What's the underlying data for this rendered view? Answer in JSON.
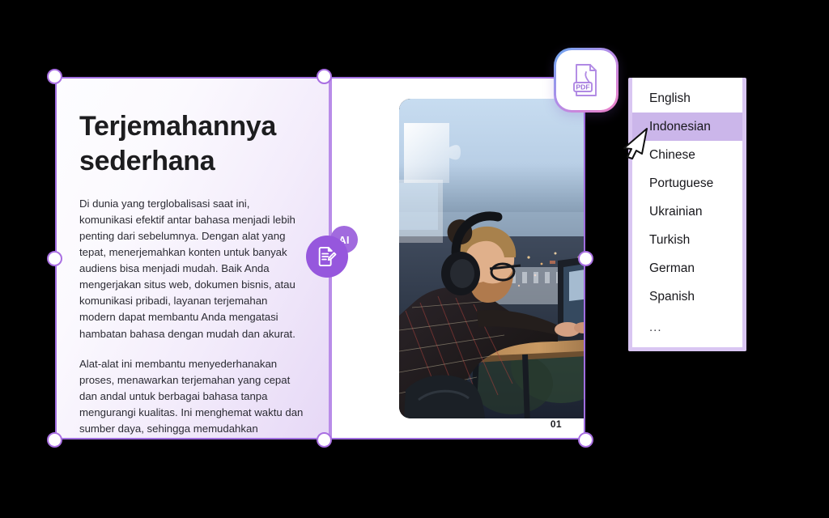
{
  "slide": {
    "title": "Terjemahannya sederhana",
    "paragraphs": [
      "Di dunia yang terglobalisasi saat ini, komunikasi efektif antar bahasa menjadi lebih penting dari sebelumnya. Dengan alat yang tepat, menerjemahkan konten untuk banyak audiens bisa menjadi mudah. Baik Anda mengerjakan situs web, dokumen bisnis, atau komunikasi pribadi, layanan terjemahan modern dapat membantu Anda mengatasi hambatan bahasa dengan mudah dan akurat.",
      "Alat-alat ini membantu menyederhanakan proses, menawarkan terjemahan yang cepat dan andal untuk berbagai bahasa tanpa mengurangi kualitas. Ini menghemat waktu dan sumber daya, sehingga memudahkan perluasan jangkauan lintas batas."
    ],
    "page_number": "01",
    "photo_alt": "Man with headphones working on a laptop at a standing desk by a window"
  },
  "badges": {
    "pdf_label": "PDF",
    "pdf_icon": "pdf-file-icon",
    "ai_label": "AI",
    "ai_icon": "document-edit-icon"
  },
  "language_dropdown": {
    "selected": "Indonesian",
    "options": [
      {
        "label": "English"
      },
      {
        "label": "Indonesian"
      },
      {
        "label": "Chinese"
      },
      {
        "label": "Portuguese"
      },
      {
        "label": "Ukrainian"
      },
      {
        "label": "Turkish"
      },
      {
        "label": "German"
      },
      {
        "label": "Spanish"
      },
      {
        "label": "..."
      }
    ]
  },
  "selection": {
    "handle_count": 8,
    "accent_color": "#a96fe2",
    "handle_fill": "#ffffff"
  },
  "colors": {
    "accent": "#a06ee0",
    "divider": "#b98ce8",
    "highlight": "#cbb6ea",
    "dropdown_border": "#d9c6f2",
    "ai_badge": "#9657dd",
    "text": "#1d1d1f",
    "canvas": "#000000"
  },
  "cursor": {
    "type": "arrow-pointer"
  }
}
